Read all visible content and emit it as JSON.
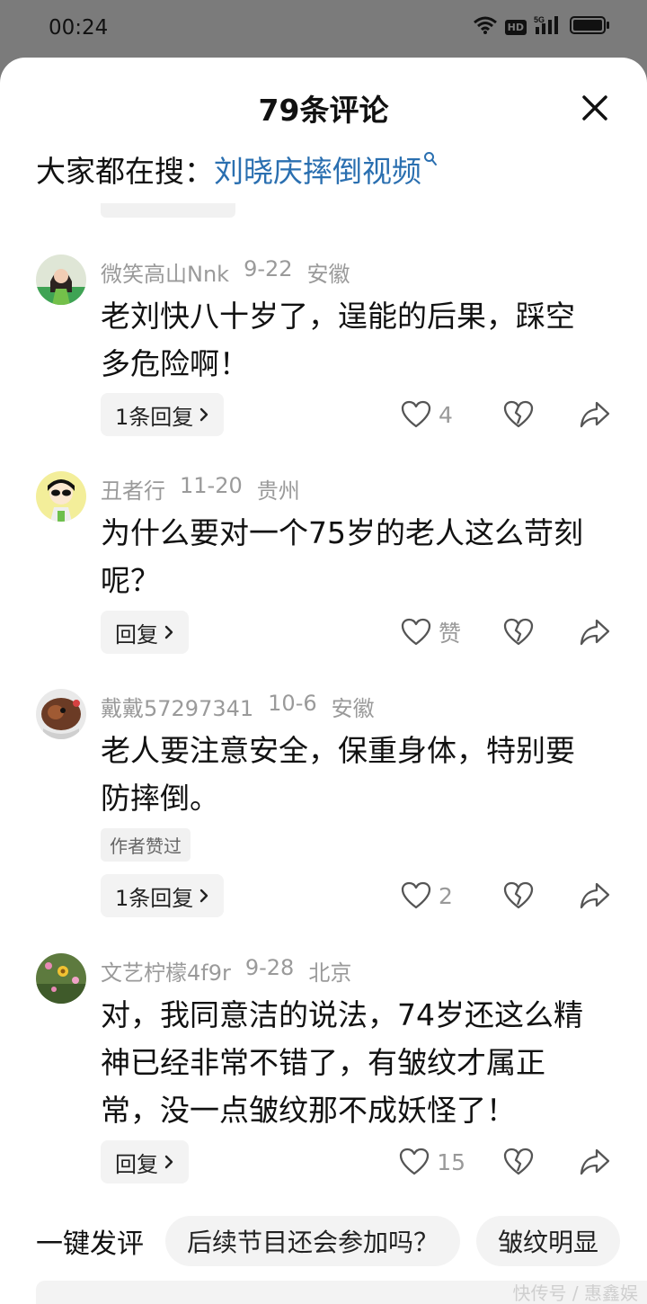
{
  "status_bar": {
    "time": "00:24",
    "hd_badge": "HD",
    "network": "5G"
  },
  "sheet": {
    "title": "79条评论"
  },
  "search": {
    "prefix": "大家都在搜：",
    "query": "刘晓庆摔倒视频"
  },
  "comments": [
    {
      "user": "微笑高山Nnk",
      "date": "9-22",
      "location": "安徽",
      "text": "老刘快八十岁了，逞能的后果，踩空多危险啊！",
      "reply_label": "1条回复",
      "like_count": "4",
      "tag": ""
    },
    {
      "user": "丑者行",
      "date": "11-20",
      "location": "贵州",
      "text": "为什么要对一个75岁的老人这么苛刻呢？",
      "reply_label": "回复",
      "like_count": "赞",
      "tag": ""
    },
    {
      "user": "戴戴57297341",
      "date": "10-6",
      "location": "安徽",
      "text": "老人要注意安全，保重身体，特别要防摔倒。",
      "reply_label": "1条回复",
      "like_count": "2",
      "tag": "作者赞过"
    },
    {
      "user": "文艺柠檬4f9r",
      "date": "9-28",
      "location": "北京",
      "text": "对，我同意洁的说法，74岁还这么精神已经非常不错了，有皱纹才属正常，没一点皱纹那不成妖怪了！",
      "reply_label": "回复",
      "like_count": "15",
      "tag": ""
    }
  ],
  "quick_comment": {
    "label": "一键发评",
    "chips": [
      "后续节目还会参加吗？",
      "皱纹明显"
    ]
  },
  "watermark": "快传号 / 惠鑫娱",
  "icons": {
    "close": "close-icon",
    "search": "search-icon",
    "like": "heart-icon",
    "dislike": "broken-heart-icon",
    "share": "share-arrow-icon",
    "chevron": "chevron-right-icon"
  },
  "colors": {
    "link": "#2a6fb0",
    "meta": "#9a9a9a",
    "chip_bg": "#f3f3f3"
  }
}
